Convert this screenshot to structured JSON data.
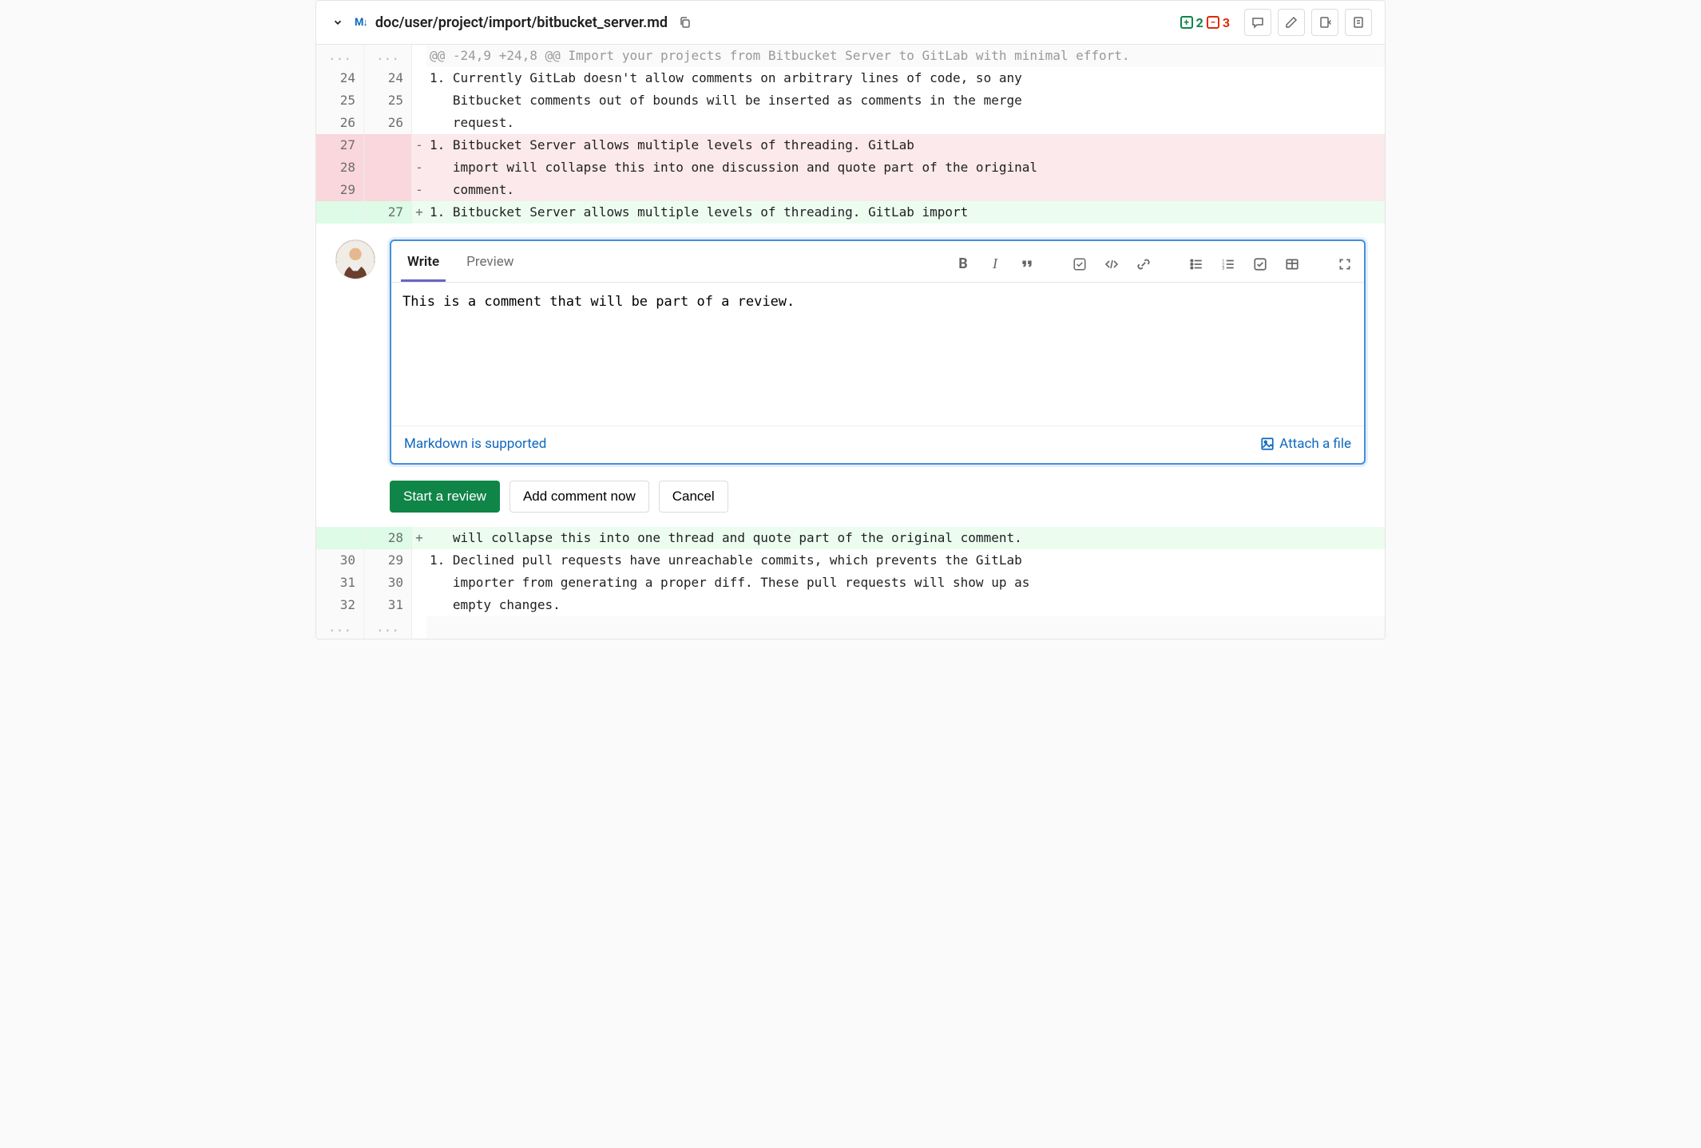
{
  "file": {
    "path": "doc/user/project/import/bitbucket_server.md",
    "additions": "2",
    "deletions": "3"
  },
  "hunk_header": "@@ -24,9 +24,8 @@ Import your projects from Bitbucket Server to GitLab with minimal effort.",
  "diff_top": [
    {
      "old": "24",
      "new": "24",
      "type": "ctx",
      "sign": " ",
      "text": "1. Currently GitLab doesn't allow comments on arbitrary lines of code, so any"
    },
    {
      "old": "25",
      "new": "25",
      "type": "ctx",
      "sign": " ",
      "text": "   Bitbucket comments out of bounds will be inserted as comments in the merge"
    },
    {
      "old": "26",
      "new": "26",
      "type": "ctx",
      "sign": " ",
      "text": "   request."
    },
    {
      "old": "27",
      "new": "",
      "type": "del",
      "sign": "-",
      "text": "1. Bitbucket Server allows multiple levels of threading. GitLab"
    },
    {
      "old": "28",
      "new": "",
      "type": "del",
      "sign": "-",
      "text": "   import will collapse this into one discussion and quote part of the original"
    },
    {
      "old": "29",
      "new": "",
      "type": "del",
      "sign": "-",
      "text": "   comment."
    },
    {
      "old": "",
      "new": "27",
      "type": "add",
      "sign": "+",
      "text": "1. Bitbucket Server allows multiple levels of threading. GitLab import"
    }
  ],
  "diff_bottom": [
    {
      "old": "",
      "new": "28",
      "type": "add",
      "sign": "+",
      "text": "   will collapse this into one thread and quote part of the original comment."
    },
    {
      "old": "30",
      "new": "29",
      "type": "ctx",
      "sign": " ",
      "text": "1. Declined pull requests have unreachable commits, which prevents the GitLab"
    },
    {
      "old": "31",
      "new": "30",
      "type": "ctx",
      "sign": " ",
      "text": "   importer from generating a proper diff. These pull requests will show up as"
    },
    {
      "old": "32",
      "new": "31",
      "type": "ctx",
      "sign": " ",
      "text": "   empty changes."
    }
  ],
  "composer": {
    "tab_write": "Write",
    "tab_preview": "Preview",
    "value": "This is a comment that will be part of a review.",
    "markdown_link": "Markdown is supported",
    "attach_link": "Attach a file"
  },
  "buttons": {
    "start_review": "Start a review",
    "add_now": "Add comment now",
    "cancel": "Cancel"
  },
  "icons": {
    "md": "M↓"
  }
}
